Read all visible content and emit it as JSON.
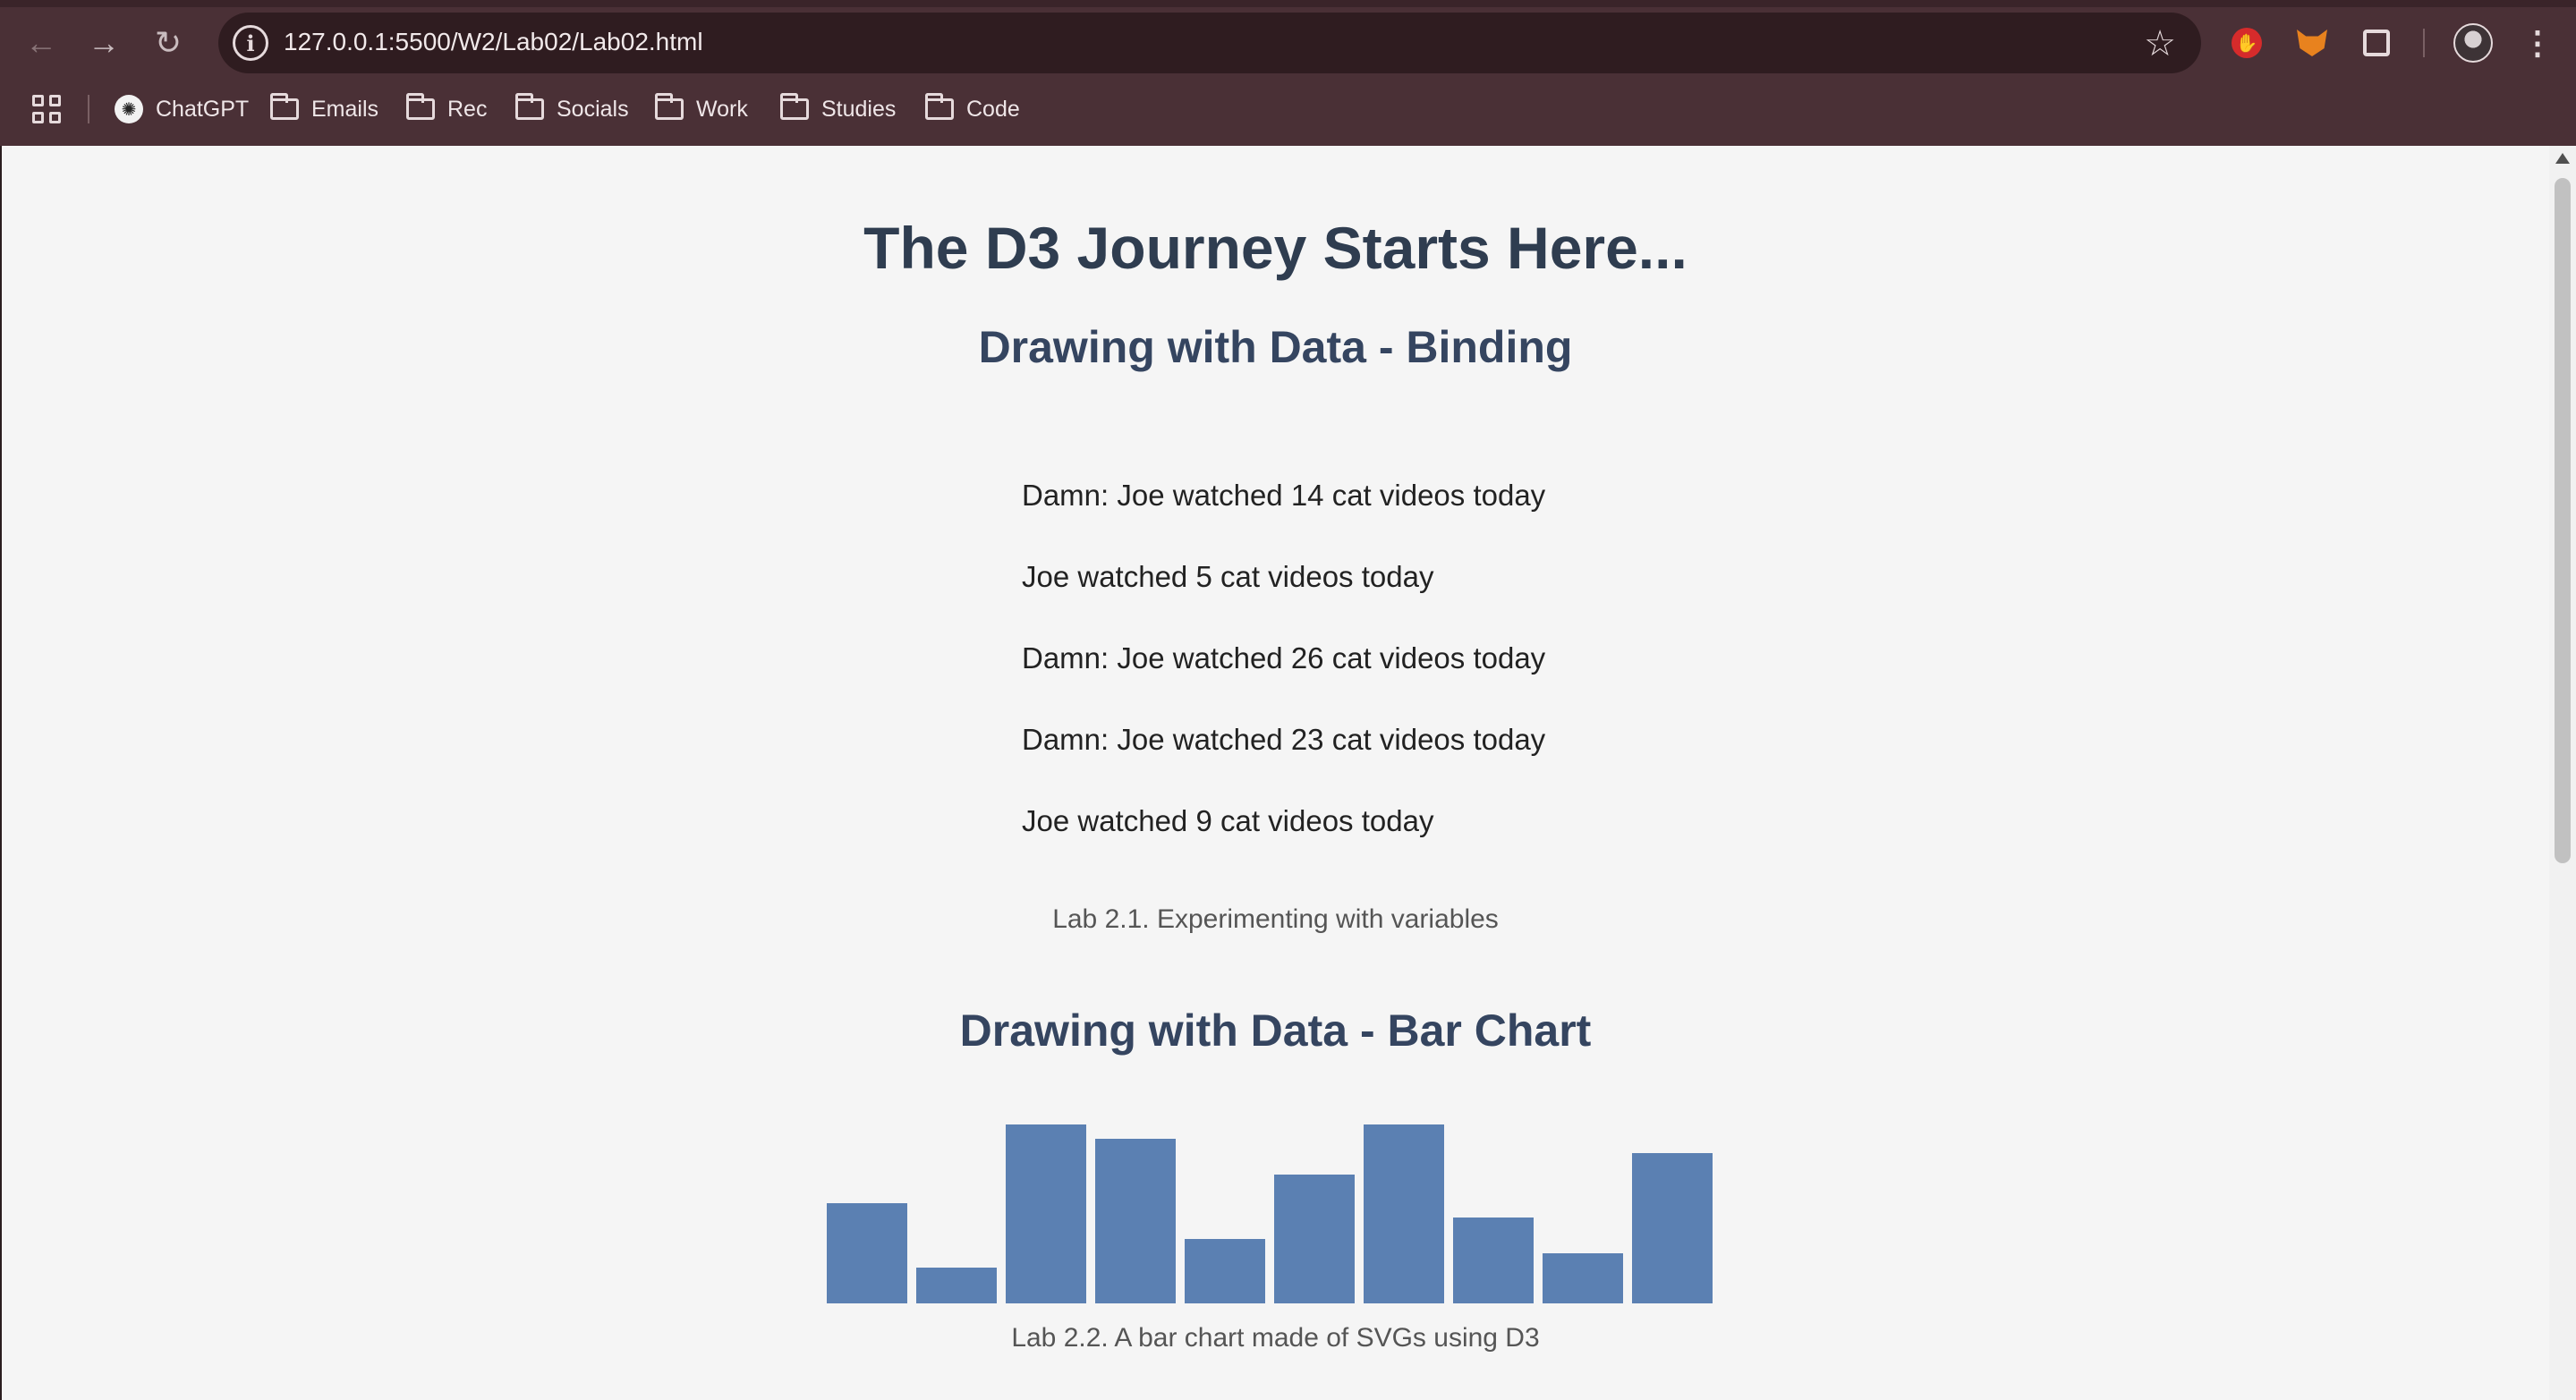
{
  "browser": {
    "url": "127.0.0.1:5500/W2/Lab02/Lab02.html",
    "bookmarks": [
      "ChatGPT",
      "Emails",
      "Rec",
      "Socials",
      "Work",
      "Studies",
      "Code"
    ]
  },
  "page": {
    "title": "The D3 Journey Starts Here...",
    "section1": {
      "heading": "Drawing with Data - Binding",
      "lines": [
        "Damn: Joe watched 14 cat videos today",
        "Joe watched 5 cat videos today",
        "Damn: Joe watched 26 cat videos today",
        "Damn: Joe watched 23 cat videos today",
        "Joe watched 9 cat videos today"
      ],
      "caption": "Lab 2.1. Experimenting with variables"
    },
    "section2": {
      "heading": "Drawing with Data - Bar Chart",
      "caption": "Lab 2.2. A bar chart made of SVGs using D3"
    }
  },
  "chart_data": {
    "type": "bar",
    "values": [
      14,
      5,
      25,
      23,
      9,
      18,
      25,
      12,
      7,
      21
    ],
    "color": "#5b80b2"
  }
}
